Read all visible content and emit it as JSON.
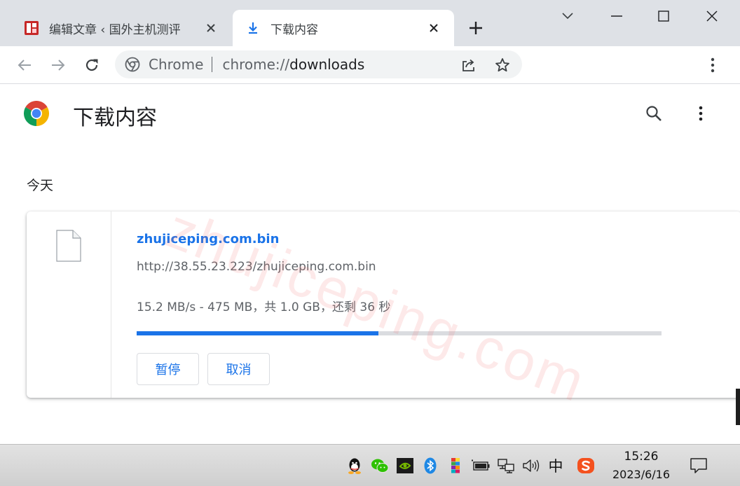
{
  "browser": {
    "tabs": [
      {
        "title": "编辑文章 ‹ 国外主机测评",
        "active": false,
        "favicon": "site-seal-icon"
      },
      {
        "title": "下载内容",
        "active": true,
        "favicon": "download-arrow-icon"
      }
    ],
    "omnibox": {
      "site_chip": "Chrome",
      "url_scheme": "chrome://",
      "url_host": "downloads"
    }
  },
  "page": {
    "title": "下载内容",
    "section_label": "今天"
  },
  "download": {
    "file_name": "zhujiceping.com.bin",
    "url": "http://38.55.23.223/zhujiceping.com.bin",
    "status": "15.2 MB/s - 475 MB，共 1.0 GB，还剩 36 秒",
    "progress": 0.46,
    "pause_label": "暂停",
    "cancel_label": "取消"
  },
  "watermark": "zhujiceping.com",
  "taskbar": {
    "tray_icons": [
      "qq-icon",
      "wechat-icon",
      "nvidia-icon",
      "bluetooth-icon",
      "palette-app-icon",
      "battery-icon",
      "network-icon",
      "volume-icon",
      "ime-indicator",
      "sogou-icon"
    ],
    "ime": "中",
    "time": "15:26",
    "date": "2023/6/16"
  },
  "colors": {
    "accent": "#1a73e8",
    "tabstrip": "#dee1e6",
    "omnibox": "#f1f3f4",
    "progress_track": "#dadce0"
  }
}
